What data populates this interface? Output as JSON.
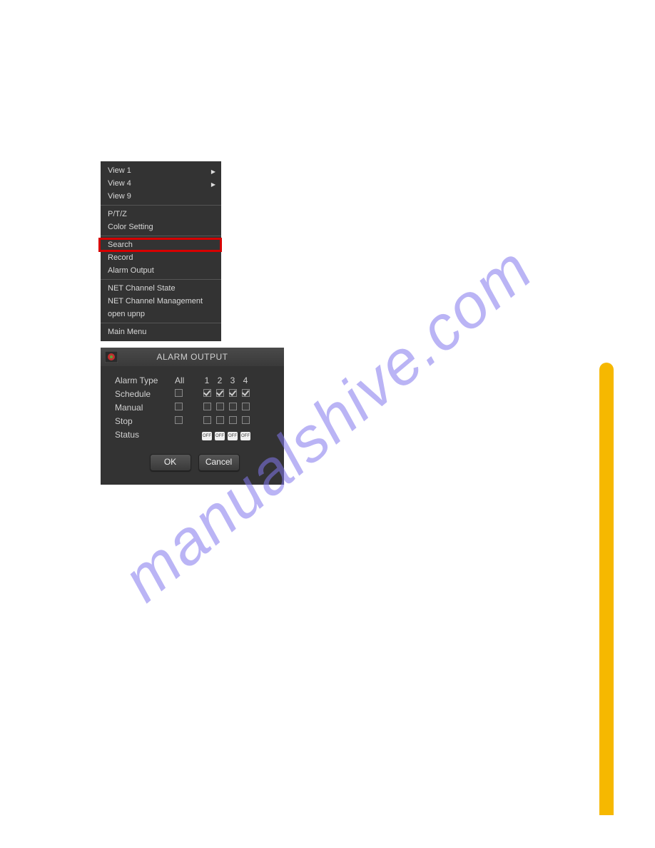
{
  "watermark": "manualshive.com",
  "context_menu": {
    "items": [
      {
        "label": "View 1",
        "submenu": true
      },
      {
        "label": "View 4",
        "submenu": true
      },
      {
        "label": "View 9",
        "submenu": false
      },
      {
        "sep": true
      },
      {
        "label": "P/T/Z",
        "submenu": false
      },
      {
        "label": "Color Setting",
        "submenu": false
      },
      {
        "sep": true
      },
      {
        "label": "Search",
        "submenu": false
      },
      {
        "label": "Record",
        "submenu": false
      },
      {
        "label": "Alarm Output",
        "submenu": false,
        "highlighted": true
      },
      {
        "sep": true
      },
      {
        "label": "NET Channel State",
        "submenu": false
      },
      {
        "label": "NET Channel Management",
        "submenu": false
      },
      {
        "label": "open upnp",
        "submenu": false
      },
      {
        "sep": true
      },
      {
        "label": "Main Menu",
        "submenu": false
      }
    ]
  },
  "alarm_panel": {
    "title": "ALARM OUTPUT",
    "header": {
      "type_label": "Alarm Type",
      "all_label": "All",
      "cols": [
        "1",
        "2",
        "3",
        "4"
      ]
    },
    "rows": [
      {
        "label": "Schedule",
        "all": false,
        "checks": [
          true,
          true,
          true,
          true
        ]
      },
      {
        "label": "Manual",
        "all": false,
        "checks": [
          false,
          false,
          false,
          false
        ]
      },
      {
        "label": "Stop",
        "all": false,
        "checks": [
          false,
          false,
          false,
          false
        ]
      }
    ],
    "status": {
      "label": "Status",
      "cells": [
        "OFF",
        "OFF",
        "OFF",
        "OFF"
      ]
    },
    "buttons": {
      "ok": "OK",
      "cancel": "Cancel"
    }
  }
}
